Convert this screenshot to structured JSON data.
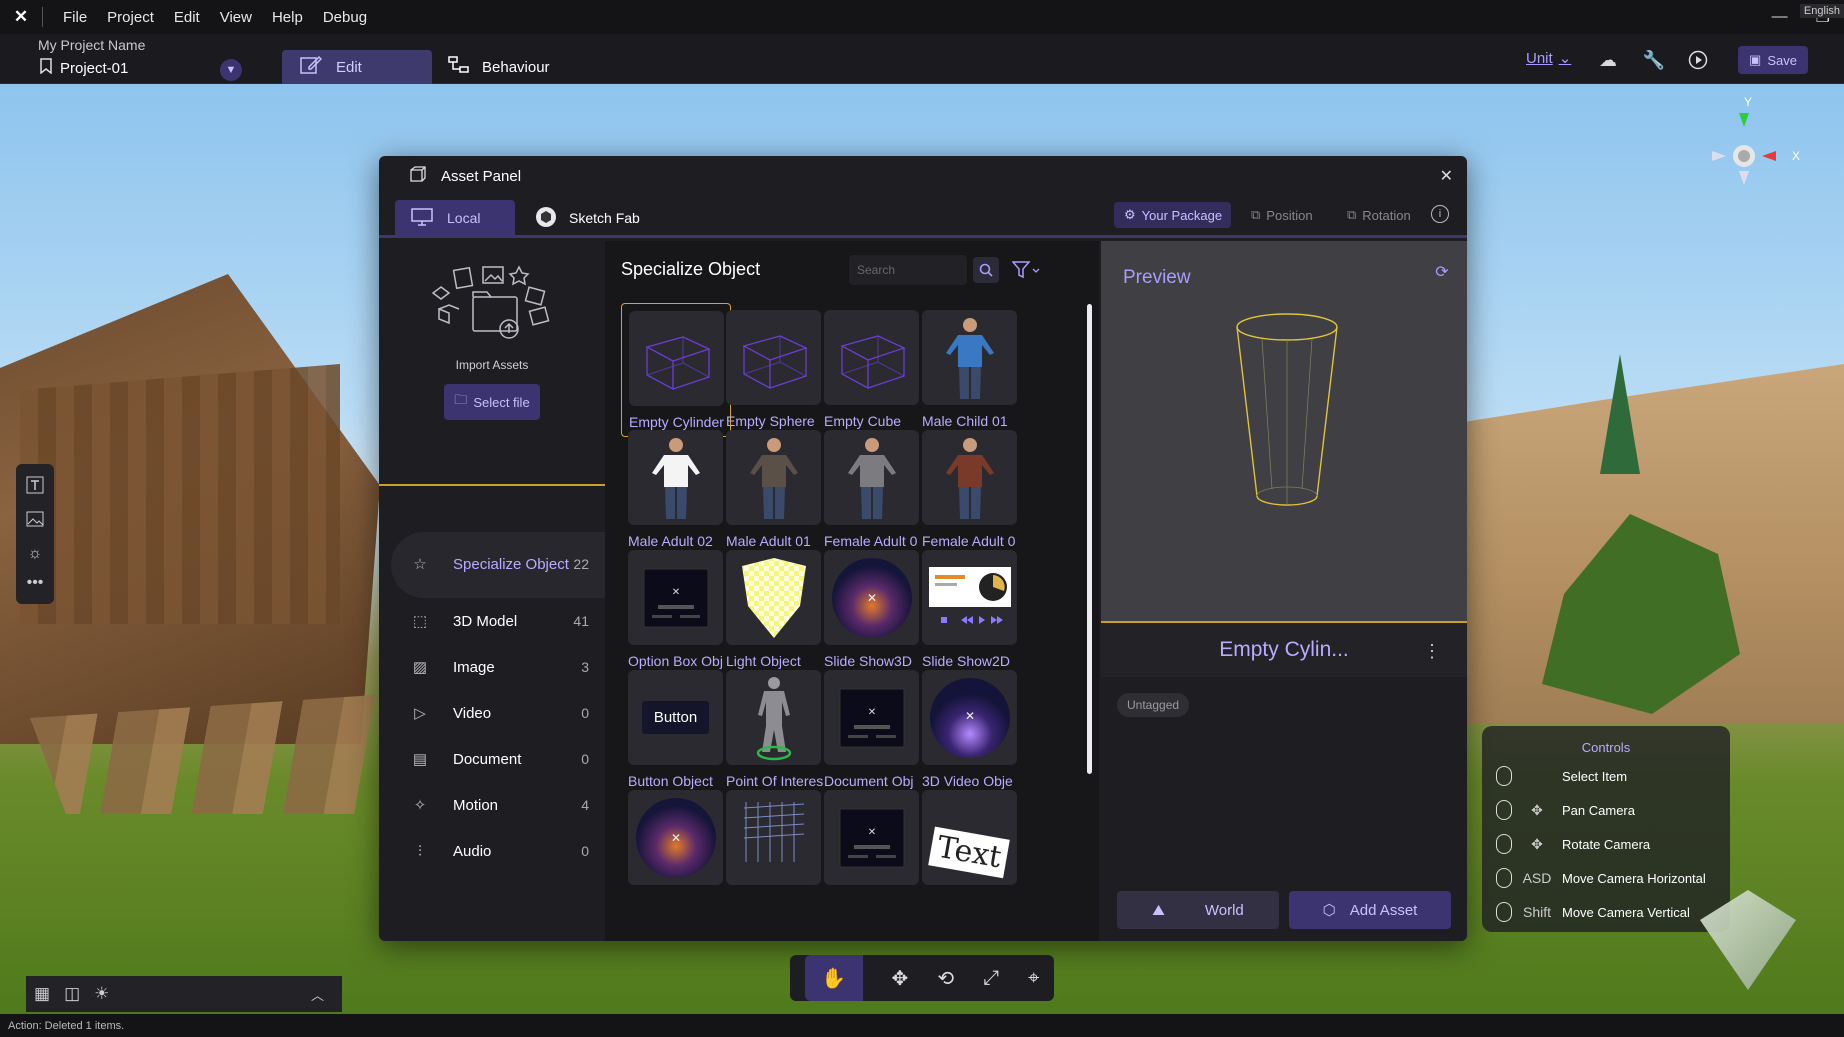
{
  "menubar": {
    "items": [
      "File",
      "Project",
      "Edit",
      "View",
      "Help",
      "Debug"
    ],
    "language": "English"
  },
  "project": {
    "name_label": "My Project Name",
    "current": "Project-01"
  },
  "toolbar": {
    "edit_tab": "Edit",
    "behaviour_tab": "Behaviour",
    "unit_label": "Unit",
    "save_label": "Save"
  },
  "gizmo": {
    "y": "Y",
    "x": "X"
  },
  "asset_panel": {
    "title": "Asset Panel",
    "tabs": {
      "local": "Local",
      "sketchfab": "Sketch Fab"
    },
    "your_package": "Your Package",
    "position": "Position",
    "rotation": "Rotation",
    "import_label": "Import Assets",
    "select_file": "Select file",
    "categories": [
      {
        "name": "Specialize Object",
        "count": "22",
        "icon": "star-icon"
      },
      {
        "name": "3D Model",
        "count": "41",
        "icon": "cube-icon"
      },
      {
        "name": "Image",
        "count": "3",
        "icon": "image-icon"
      },
      {
        "name": "Video",
        "count": "0",
        "icon": "play-icon"
      },
      {
        "name": "Document",
        "count": "0",
        "icon": "document-icon"
      },
      {
        "name": "Motion",
        "count": "4",
        "icon": "motion-icon"
      },
      {
        "name": "Audio",
        "count": "0",
        "icon": "audio-icon"
      }
    ],
    "grid_title": "Specialize Object",
    "search_placeholder": "Search",
    "items": [
      {
        "name": "Empty Cylinder",
        "kind": "box",
        "selected": true
      },
      {
        "name": "Empty Sphere",
        "kind": "box"
      },
      {
        "name": "Empty Cube",
        "kind": "box"
      },
      {
        "name": "Male Child 01",
        "kind": "person",
        "color": "#3a78c4"
      },
      {
        "name": "Male Adult 02",
        "kind": "person",
        "color": "#f4f4f4"
      },
      {
        "name": "Male Adult 01",
        "kind": "person",
        "color": "#5a5048"
      },
      {
        "name": "Female Adult 0",
        "kind": "person",
        "color": "#7c7c80"
      },
      {
        "name": "Female Adult 0",
        "kind": "person",
        "color": "#7a3a2a"
      },
      {
        "name": "Option Box Obj",
        "kind": "screen"
      },
      {
        "name": "Light Object",
        "kind": "light"
      },
      {
        "name": "Slide Show3D",
        "kind": "orb"
      },
      {
        "name": "Slide Show2D",
        "kind": "slide"
      },
      {
        "name": "Button Object",
        "kind": "button",
        "button_text": "Button"
      },
      {
        "name": "Point Of Interes",
        "kind": "statue"
      },
      {
        "name": "Document Obj",
        "kind": "screen"
      },
      {
        "name": "3D Video Obje",
        "kind": "orb2"
      },
      {
        "name": "",
        "kind": "orb"
      },
      {
        "name": "",
        "kind": "grid3d"
      },
      {
        "name": "",
        "kind": "screen"
      },
      {
        "name": "",
        "kind": "text3d",
        "button_text": "Text"
      }
    ],
    "preview": {
      "title": "Preview",
      "name": "Empty Cylin...",
      "tag": "Untagged",
      "world": "World",
      "add_asset": "Add Asset"
    }
  },
  "controls": {
    "title": "Controls",
    "items": [
      {
        "label": "Select Item",
        "key": ""
      },
      {
        "label": "Pan Camera",
        "key": "✥"
      },
      {
        "label": "Rotate Camera",
        "key": "✥"
      },
      {
        "label": "Move Camera Horizontal",
        "key": "ASD"
      },
      {
        "label": "Move Camera Vertical",
        "key": "Shift"
      }
    ]
  },
  "status": {
    "text": "Action: Deleted 1 items."
  },
  "colors": {
    "accent": "#3b3470",
    "accent_text": "#b7acff",
    "highlight": "#d9a330"
  }
}
